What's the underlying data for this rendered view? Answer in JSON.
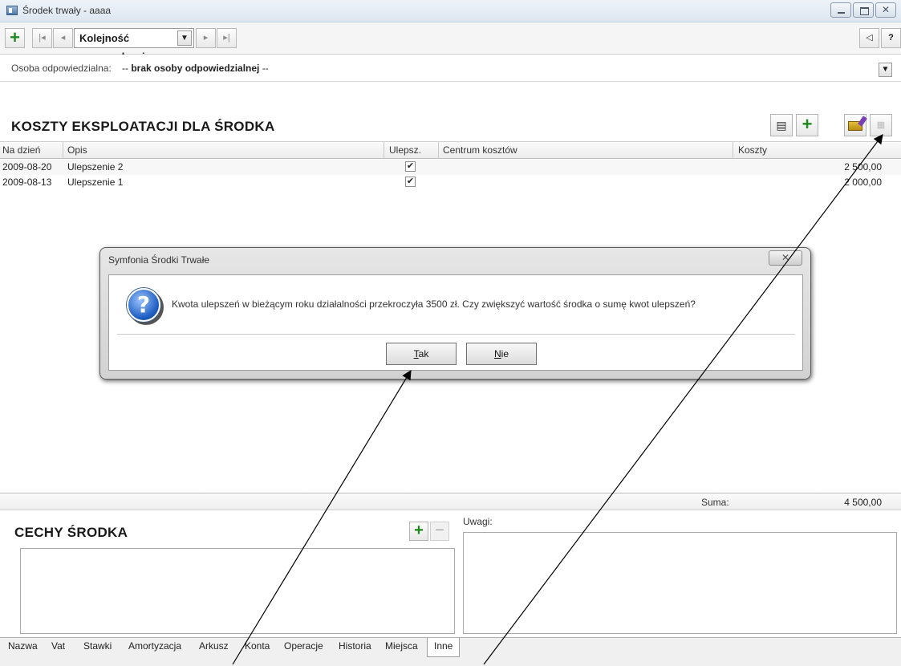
{
  "window": {
    "title": "Środek trwały - aaaa"
  },
  "toolbar": {
    "order_value": "Kolejność wprowadzenia",
    "help_label": "?"
  },
  "person": {
    "label": "Osoba odpowiedzialna:",
    "value_prefix": "--",
    "value": "brak osoby odpowiedzialnej",
    "value_suffix": "--"
  },
  "costs": {
    "title": "KOSZTY EKSPLOATACJI DLA ŚRODKA",
    "columns": [
      "Na dzień",
      "Opis",
      "Ulepsz.",
      "Centrum kosztów",
      "Koszty"
    ],
    "rows": [
      {
        "date": "2009-08-20",
        "desc": "Ulepszenie 2",
        "upgrade": true,
        "center": "",
        "cost": "2 500,00"
      },
      {
        "date": "2009-08-13",
        "desc": "Ulepszenie 1",
        "upgrade": true,
        "center": "",
        "cost": "2 000,00"
      }
    ],
    "sum_label": "Suma:",
    "sum_value": "4 500,00"
  },
  "features": {
    "title": "CECHY ŚRODKA",
    "notes_label": "Uwagi:"
  },
  "tabs": [
    "Nazwa",
    "Vat",
    "Stawki",
    "Amortyzacja",
    "Arkusz",
    "Konta",
    "Operacje",
    "Historia",
    "Miejsca",
    "Inne"
  ],
  "active_tab": "Inne",
  "dialog": {
    "title": "Symfonia Środki Trwałe",
    "message": "Kwota ulepszeń w bieżącym roku działalności przekroczyła 3500 zł. Czy zwiększyć wartość środka o sumę kwot ulepszeń?",
    "yes_key": "T",
    "yes_rest": "ak",
    "no_key": "N",
    "no_rest": "ie"
  },
  "colors": {
    "accent_green": "#1e8a1e",
    "dialog_icon_blue": "#1f5fc2"
  },
  "icons": [
    "window-icon",
    "add-icon",
    "first-record-icon",
    "previous-record-icon",
    "next-record-icon",
    "last-record-icon",
    "collapse-icon",
    "help-icon",
    "properties-icon",
    "edit-icon",
    "question-icon",
    "close-icon"
  ]
}
